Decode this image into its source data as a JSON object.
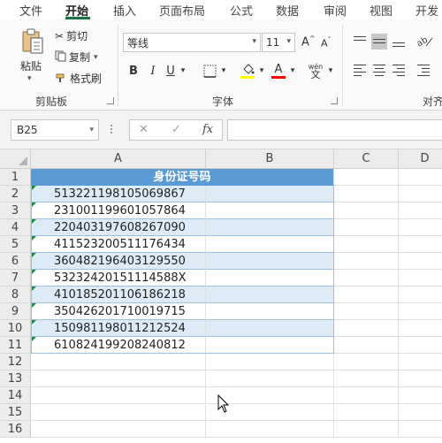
{
  "menu": {
    "tabs": [
      {
        "label": "文件"
      },
      {
        "label": "开始"
      },
      {
        "label": "插入"
      },
      {
        "label": "页面布局"
      },
      {
        "label": "公式"
      },
      {
        "label": "数据"
      },
      {
        "label": "审阅"
      },
      {
        "label": "视图"
      },
      {
        "label": "开发"
      }
    ],
    "active_tab": "开始"
  },
  "ribbon": {
    "clipboard": {
      "paste": "粘贴",
      "cut": "剪切",
      "copy": "复制",
      "format_painter": "格式刷",
      "group_label": "剪贴板"
    },
    "font": {
      "font_name": "等线",
      "font_size": "11",
      "bold": "B",
      "italic": "I",
      "underline": "U",
      "grow": "A",
      "shrink": "A",
      "font_color_letter": "A",
      "phonetic_top": "wén",
      "phonetic_bottom": "文",
      "group_label": "字体"
    },
    "alignment": {
      "group_label": "对齐"
    },
    "colors": {
      "fill_highlight": "#ffff00",
      "font_color": "#ff0000",
      "accent": "#1e7145"
    }
  },
  "formula_bar": {
    "name_box": "B25",
    "cancel": "✕",
    "enter": "✓",
    "fx": "fx",
    "formula": ""
  },
  "sheet": {
    "columns": [
      "A",
      "B",
      "C",
      "D"
    ],
    "rows": [
      "1",
      "2",
      "3",
      "4",
      "5",
      "6",
      "7",
      "8",
      "9",
      "10",
      "11",
      "12",
      "13",
      "14",
      "15",
      "16"
    ],
    "header": "身份证号码",
    "ids": [
      "513221198105069867",
      "231001199601057864",
      "220403197608267090",
      "411523200511176434",
      "360482196403129550",
      "53232420151114588X",
      "410185201106186218",
      "350426201710019715",
      "150981198011212524",
      "610824199208240812"
    ],
    "table_colors": {
      "header_fill": "#5b9bd5",
      "band_fill": "#ddebf7",
      "border": "#9bc2e6",
      "error_flag": "#1e8a3c"
    }
  }
}
